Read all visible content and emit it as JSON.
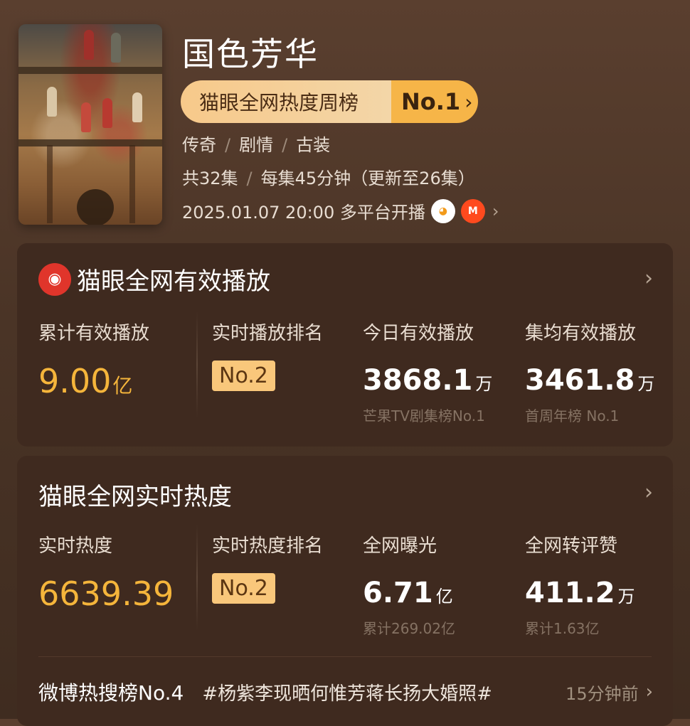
{
  "show": {
    "title": "国色芳华",
    "poster_text": "国色芳华",
    "rank_label": "猫眼全网热度周榜",
    "rank_value": "No.1",
    "genres": [
      "传奇",
      "剧情",
      "古装"
    ],
    "episodes": "共32集",
    "episode_info": "每集45分钟（更新至26集）",
    "premiere": "2025.01.07 20:00 多平台开播",
    "platforms": [
      "mango-tv-icon",
      "mgtv-icon"
    ]
  },
  "playback": {
    "title": "猫眼全网有效播放",
    "logo_icon": "maoyan-cat-icon",
    "total_label": "累计有效播放",
    "total_value": "9.00",
    "total_unit": "亿",
    "rank_label": "实时播放排名",
    "rank_value": "No.2",
    "today_label": "今日有效播放",
    "today_value": "3868.1",
    "today_unit": "万",
    "today_sub": "芒果TV剧集榜No.1",
    "avg_label": "集均有效播放",
    "avg_value": "3461.8",
    "avg_unit": "万",
    "avg_sub": "首周年榜 No.1"
  },
  "heat": {
    "title": "猫眼全网实时热度",
    "heat_label": "实时热度",
    "heat_value": "6639.39",
    "rank_label": "实时热度排名",
    "rank_value": "No.2",
    "exposure_label": "全网曝光",
    "exposure_value": "6.71",
    "exposure_unit": "亿",
    "exposure_sub": "累计269.02亿",
    "engage_label": "全网转评赞",
    "engage_value": "411.2",
    "engage_unit": "万",
    "engage_sub": "累计1.63亿"
  },
  "weibo": {
    "title": "微博热搜榜No.4",
    "tag": "#杨紫李现晒何惟芳蒋长扬大婚照#",
    "time": "15分钟前"
  },
  "colors": {
    "gold": "#f5b53b",
    "badge_bg": "#f9c77b",
    "card_bg": "#3f2a1f",
    "page_bg": "#4a3426"
  }
}
